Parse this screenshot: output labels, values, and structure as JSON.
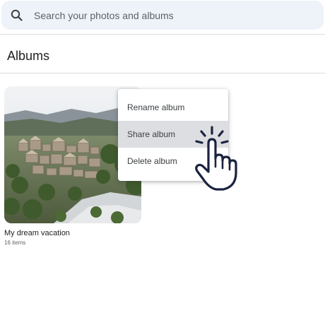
{
  "search": {
    "placeholder": "Search your photos and albums",
    "icon": "search-icon"
  },
  "page": {
    "title": "Albums"
  },
  "album": {
    "title": "My dream vacation",
    "count": "16 items"
  },
  "context_menu": {
    "items": [
      {
        "label": "Rename album",
        "hovered": false
      },
      {
        "label": "Share album",
        "hovered": true
      },
      {
        "label": "Delete album",
        "hovered": false
      }
    ]
  },
  "cursor": {
    "icon": "pointing-hand-cursor-icon"
  },
  "colors": {
    "search_bg": "#eef2f9",
    "divider": "#dadce0",
    "menu_hover": "#dcdee2",
    "cursor_stroke": "#1a2340"
  }
}
